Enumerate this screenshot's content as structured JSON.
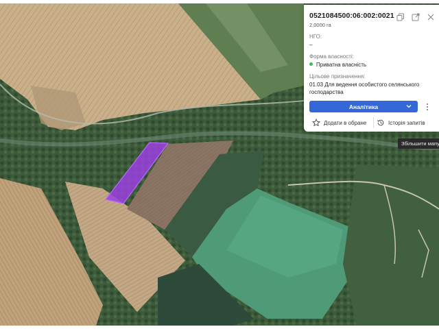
{
  "parcel": {
    "cadastral_number": "0521084500:06:002:0021",
    "area": "2,0000 га",
    "ngo_label": "НГО:",
    "ngo_value": "–",
    "ownership_label": "Форма власності:",
    "ownership_value": "Приватна власність",
    "purpose_label": "Цільове призначення:",
    "purpose_value": "01.03 Для ведення особистого селянського господарства"
  },
  "buttons": {
    "analytics": "Аналітика",
    "add_favorite": "Додати в обране",
    "history": "Історія запитів"
  },
  "tooltip": {
    "zoom_map": "Збільшити мапу"
  },
  "colors": {
    "accent": "#3468d8",
    "ownership_status": "#3cba54",
    "parcel_highlight": "#9b3fe0"
  },
  "icons": {
    "copy": "copy-icon",
    "open_external": "external-link-icon",
    "close": "close-icon",
    "dropdown": "chevron-down-icon",
    "more": "more-vertical-icon",
    "favorite": "star-icon",
    "history": "history-icon"
  }
}
